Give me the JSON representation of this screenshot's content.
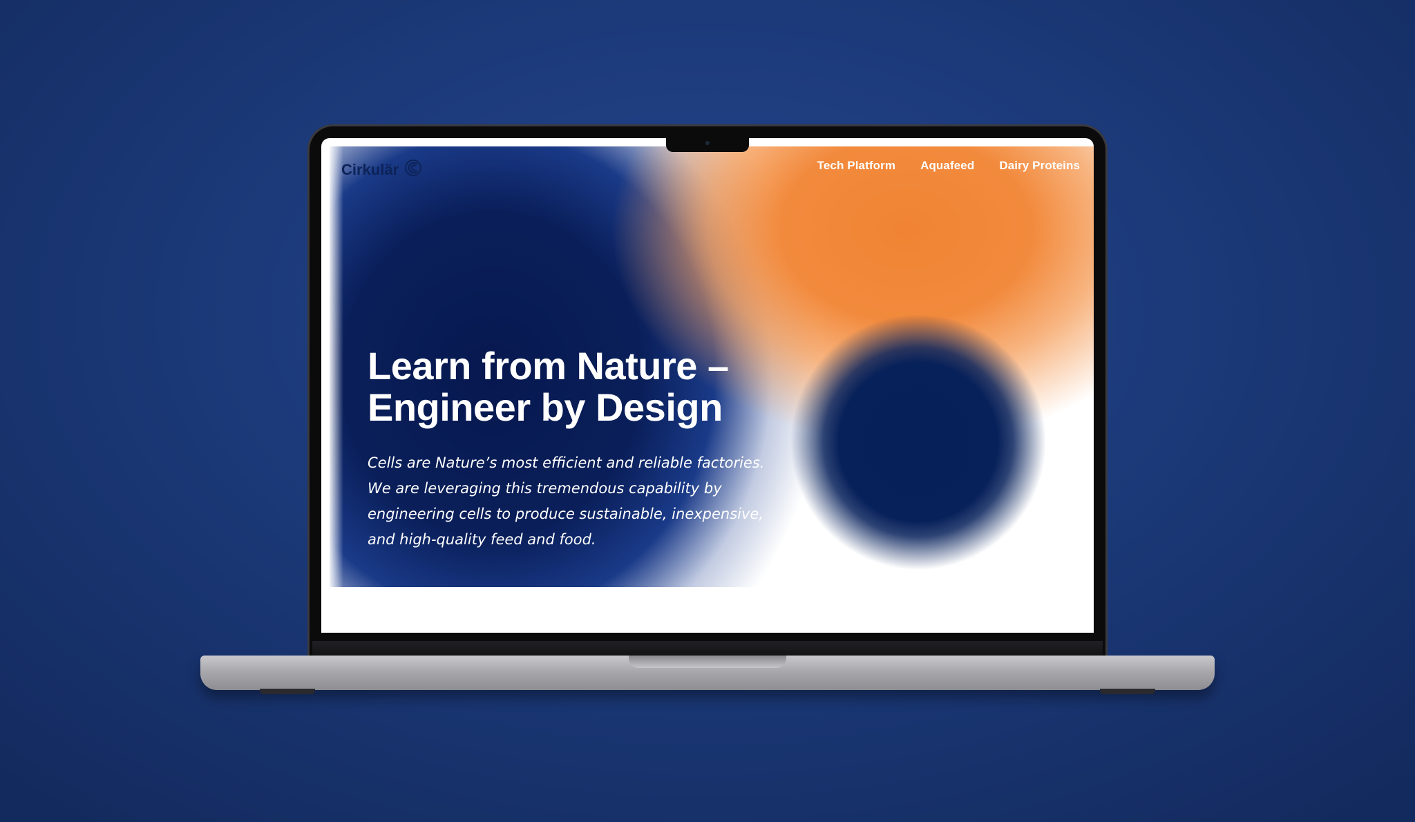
{
  "site": {
    "brand_name": "Cirkulär",
    "logo_icon": "circular-c-logo-icon"
  },
  "nav": {
    "items": [
      {
        "label": "Tech Platform"
      },
      {
        "label": "Aquafeed"
      },
      {
        "label": "Dairy Proteins"
      }
    ]
  },
  "hero": {
    "headline_lines": [
      "Learn from Nature –",
      "Engineer by Design"
    ],
    "body_lines": [
      "Cells are Nature’s most efficient and reliable factories.",
      "We are leveraging this tremendous capability by",
      "engineering cells to produce sustainable, inexpensive,",
      "and high-quality feed and food."
    ]
  },
  "colors": {
    "background": "#1c3a7a",
    "brand_navy": "#0d2357",
    "accent_orange": "#f08433",
    "hero_text": "#ffffff"
  }
}
